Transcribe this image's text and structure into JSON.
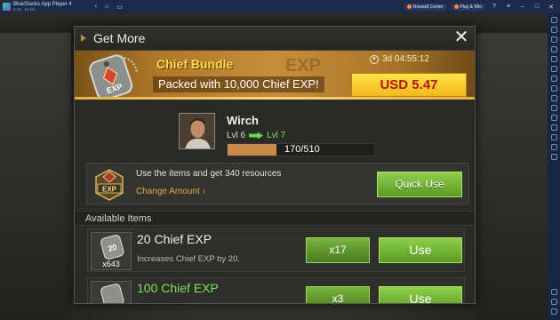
{
  "window": {
    "app_title": "BlueStacks App Player 4",
    "app_subtitle": "5.16 · 64 bit",
    "reward_center": "Reward Center",
    "play_win": "Play & Win"
  },
  "modal": {
    "title": "Get More",
    "bundle": {
      "name": "Chief Bundle",
      "description": "Packed with 10,000 Chief EXP!",
      "timer": "3d 04:55:12",
      "price": "USD 5.47",
      "watermark": "EXP"
    },
    "chief": {
      "name": "Wirch",
      "level_current": "Lvl 6",
      "level_next": "Lvl 7",
      "exp_text": "170/510",
      "exp_progress": 0.333
    },
    "quick_use": {
      "text": "Use the items and get 340 resources",
      "change_amount": "Change Amount ›",
      "button": "Quick Use"
    },
    "available_header": "Available Items",
    "items": [
      {
        "name": "20 Chief EXP",
        "name_color": "#f0efe8",
        "description": "Increases Chief EXP by 20.",
        "owned": "x643",
        "icon_label": "20",
        "multiplier": "x17",
        "use": "Use"
      },
      {
        "name": "100 Chief EXP",
        "name_color": "#7fe05a",
        "description": "",
        "owned": "",
        "icon_label": "",
        "multiplier": "x3",
        "use": "Use"
      }
    ]
  }
}
